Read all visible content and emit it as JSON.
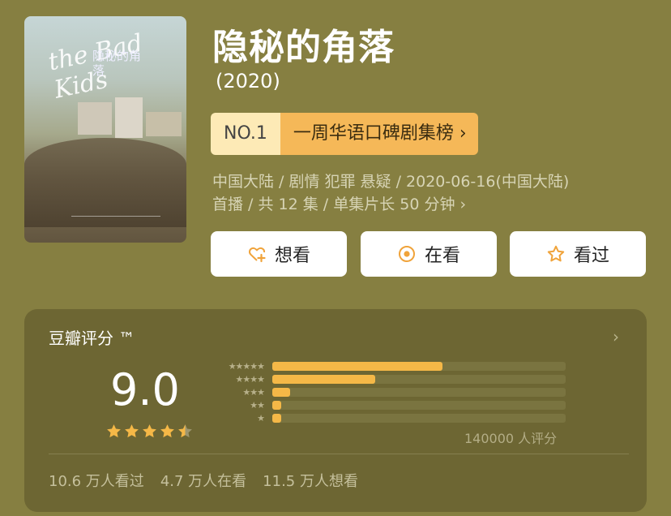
{
  "poster": {
    "title_en": "the Bad Kids",
    "title_cn": "隐秘的角落"
  },
  "show": {
    "title": "隐秘的角落",
    "year": "(2020)"
  },
  "ranking": {
    "no": "NO.1",
    "label": "一周华语口碑剧集榜 ›"
  },
  "meta": {
    "line1": "中国大陆 / 剧情 犯罪 悬疑 / 2020-06-16(中国大陆)",
    "line2": "首播 / 共 12 集 / 单集片长 50 分钟 ›"
  },
  "actions": {
    "want": "想看",
    "watching": "在看",
    "watched": "看过"
  },
  "rating": {
    "title": "豆瓣评分 ™",
    "chevron": "›",
    "score": "9.0",
    "stars_value": 4.5,
    "total": "140000 人评分",
    "distribution": [
      {
        "stars": "★★★★★",
        "fraction": 0.58
      },
      {
        "stars": "★★★★",
        "fraction": 0.35
      },
      {
        "stars": "★★★",
        "fraction": 0.06
      },
      {
        "stars": "★★",
        "fraction": 0.03
      },
      {
        "stars": "★",
        "fraction": 0.03
      }
    ],
    "colors": {
      "accent": "#f5b847"
    }
  },
  "stats": {
    "watched": "10.6 万人看过",
    "watching": "4.7 万人在看",
    "want": "11.5 万人想看"
  }
}
